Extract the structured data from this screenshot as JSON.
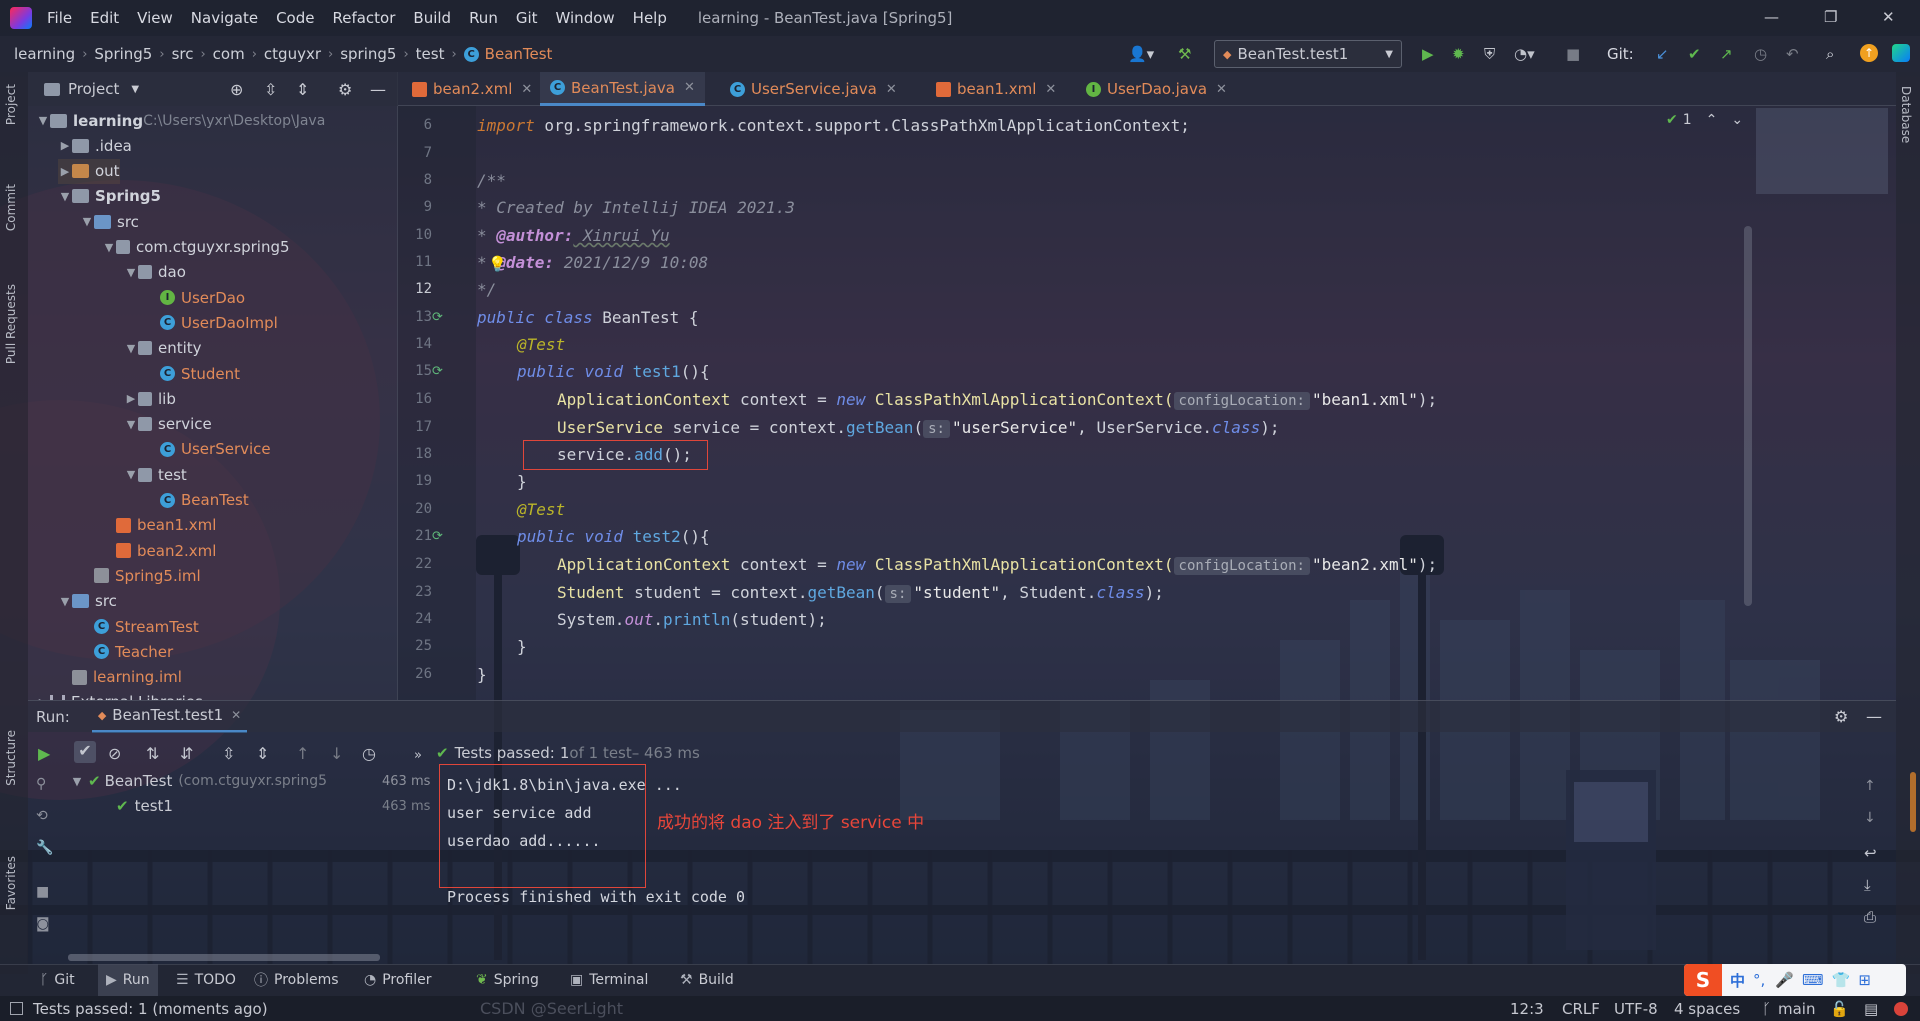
{
  "menu": [
    "File",
    "Edit",
    "View",
    "Navigate",
    "Code",
    "Refactor",
    "Build",
    "Run",
    "Git",
    "Window",
    "Help"
  ],
  "window_title": "learning - BeanTest.java [Spring5]",
  "breadcrumb": [
    "learning",
    "Spring5",
    "src",
    "com",
    "ctguyxr",
    "spring5",
    "test",
    "BeanTest"
  ],
  "run_config": "BeanTest.test1",
  "git_label": "Git:",
  "left_stripe": [
    "Project",
    "Commit",
    "Pull Requests",
    "Structure",
    "Favorites"
  ],
  "right_stripe": [
    "Database"
  ],
  "project": {
    "title": "Project",
    "root_path": "C:\\Users\\yxr\\Desktop\\Java",
    "tree": [
      {
        "label": "learning",
        "type": "module",
        "indent": 0,
        "arrow": "down"
      },
      {
        "label": ".idea",
        "type": "folder",
        "indent": 1,
        "arrow": "right"
      },
      {
        "label": "out",
        "type": "folder-orange",
        "indent": 1,
        "arrow": "right"
      },
      {
        "label": "Spring5",
        "type": "module",
        "indent": 1,
        "arrow": "down"
      },
      {
        "label": "src",
        "type": "folder-blue",
        "indent": 2,
        "arrow": "down"
      },
      {
        "label": "com.ctguyxr.spring5",
        "type": "package",
        "indent": 3,
        "arrow": "down"
      },
      {
        "label": "dao",
        "type": "package",
        "indent": 4,
        "arrow": "down"
      },
      {
        "label": "UserDao",
        "type": "interface",
        "indent": 5,
        "arrow": ""
      },
      {
        "label": "UserDaoImpl",
        "type": "class",
        "indent": 5,
        "arrow": ""
      },
      {
        "label": "entity",
        "type": "package",
        "indent": 4,
        "arrow": "down"
      },
      {
        "label": "Student",
        "type": "class",
        "indent": 5,
        "arrow": ""
      },
      {
        "label": "lib",
        "type": "package",
        "indent": 4,
        "arrow": "right"
      },
      {
        "label": "service",
        "type": "package",
        "indent": 4,
        "arrow": "down"
      },
      {
        "label": "UserService",
        "type": "class",
        "indent": 5,
        "arrow": ""
      },
      {
        "label": "test",
        "type": "package",
        "indent": 4,
        "arrow": "down"
      },
      {
        "label": "BeanTest",
        "type": "class-test",
        "indent": 5,
        "arrow": ""
      },
      {
        "label": "bean1.xml",
        "type": "xml",
        "indent": 3,
        "arrow": ""
      },
      {
        "label": "bean2.xml",
        "type": "xml",
        "indent": 3,
        "arrow": ""
      },
      {
        "label": "Spring5.iml",
        "type": "iml",
        "indent": 2,
        "arrow": ""
      },
      {
        "label": "src",
        "type": "folder-blue",
        "indent": 1,
        "arrow": "down"
      },
      {
        "label": "StreamTest",
        "type": "class",
        "indent": 2,
        "arrow": ""
      },
      {
        "label": "Teacher",
        "type": "class",
        "indent": 2,
        "arrow": ""
      },
      {
        "label": "learning.iml",
        "type": "iml",
        "indent": 1,
        "arrow": ""
      },
      {
        "label": "External Libraries",
        "type": "libs",
        "indent": 0,
        "arrow": "right"
      }
    ]
  },
  "editor_tabs": [
    {
      "label": "bean2.xml",
      "icon": "xml",
      "active": false
    },
    {
      "label": "BeanTest.java",
      "icon": "class",
      "active": true
    },
    {
      "label": "UserService.java",
      "icon": "class",
      "active": false
    },
    {
      "label": "bean1.xml",
      "icon": "xml",
      "active": false
    },
    {
      "label": "UserDao.java",
      "icon": "interface",
      "active": false
    }
  ],
  "code": {
    "line_numbers": [
      "6",
      "7",
      "8",
      "9",
      "10",
      "11",
      "12",
      "13",
      "14",
      "15",
      "16",
      "17",
      "18",
      "19",
      "20",
      "21",
      "22",
      "23",
      "24",
      "25",
      "26"
    ],
    "import_kw": "import",
    "import_path": " org.springframework.context.support.ClassPathXmlApplicationContext;",
    "doc_open": "/**",
    "doc_created": "* Created by Intellij IDEA 2021.3",
    "doc_star": "* ",
    "doc_author_tag": "@author:",
    "doc_author": " Xinrui Yu",
    "doc_date_tag": "@date:",
    "doc_date": " 2021/12/9 10:08",
    "doc_close": "*/",
    "kw_public": "public",
    "kw_class": " class",
    "class_name": " BeanTest {",
    "annotation": "@Test",
    "kw_void": " void",
    "m_test1": " test1",
    "m_test2": " test2",
    "paren_open": "(){",
    "type_appctx": "ApplicationContext",
    "var_context": " context = ",
    "kw_new": "new",
    "cpxac": " ClassPathXmlApplicationContext(",
    "hint_config": "configLocation:",
    "str_bean1": "\"bean1.xml\"",
    "str_bean2": "\"bean2.xml\"",
    "close_semi": ");",
    "type_us": "UserService",
    "var_service": " service = context.",
    "getbean": "getBean",
    "paren": "(",
    "hint_s": "s:",
    "str_userservice": "\"userService\"",
    "comma_us": ", UserService.",
    "kw_classref": "class",
    "call_service": "service.",
    "call_add": "add",
    "call_end": "();",
    "close_brace": "}",
    "type_student": "Student",
    "var_student": " student = context.",
    "str_student": "\"student\"",
    "comma_student": ", Student.",
    "sys": "System.",
    "out": "out",
    "dot": ".",
    "println": "println",
    "println_arg": "(student);",
    "inspection_count": "1"
  },
  "run": {
    "label": "Run:",
    "tab": "BeanTest.test1",
    "status_passed": "Tests passed:",
    "status_count": "1",
    "status_of": " of 1 test",
    "status_time": " – 463 ms",
    "tree": [
      {
        "label": "BeanTest",
        "sub": "(com.ctguyxr.spring5",
        "time": "463 ms"
      },
      {
        "label": "test1",
        "sub": "",
        "time": "463 ms"
      }
    ],
    "console": [
      "D:\\jdk1.8\\bin\\java.exe ...",
      "user service add",
      "userdao add......",
      "",
      "Process finished with exit code 0"
    ],
    "annotation": "成功的将 dao 注入到了 service 中"
  },
  "bottom_tabs": [
    "Git",
    "Run",
    "TODO",
    "Problems",
    "Profiler",
    "Spring",
    "Terminal",
    "Build"
  ],
  "status": {
    "left": "Tests passed: 1 (moments ago)",
    "position": "12:3",
    "line_sep": "CRLF",
    "encoding": "UTF-8",
    "indent": "4 spaces",
    "branch": "main",
    "watermark": "CSDN @SeerLight"
  },
  "ime": {
    "lang": "中",
    "punct": "°,"
  }
}
